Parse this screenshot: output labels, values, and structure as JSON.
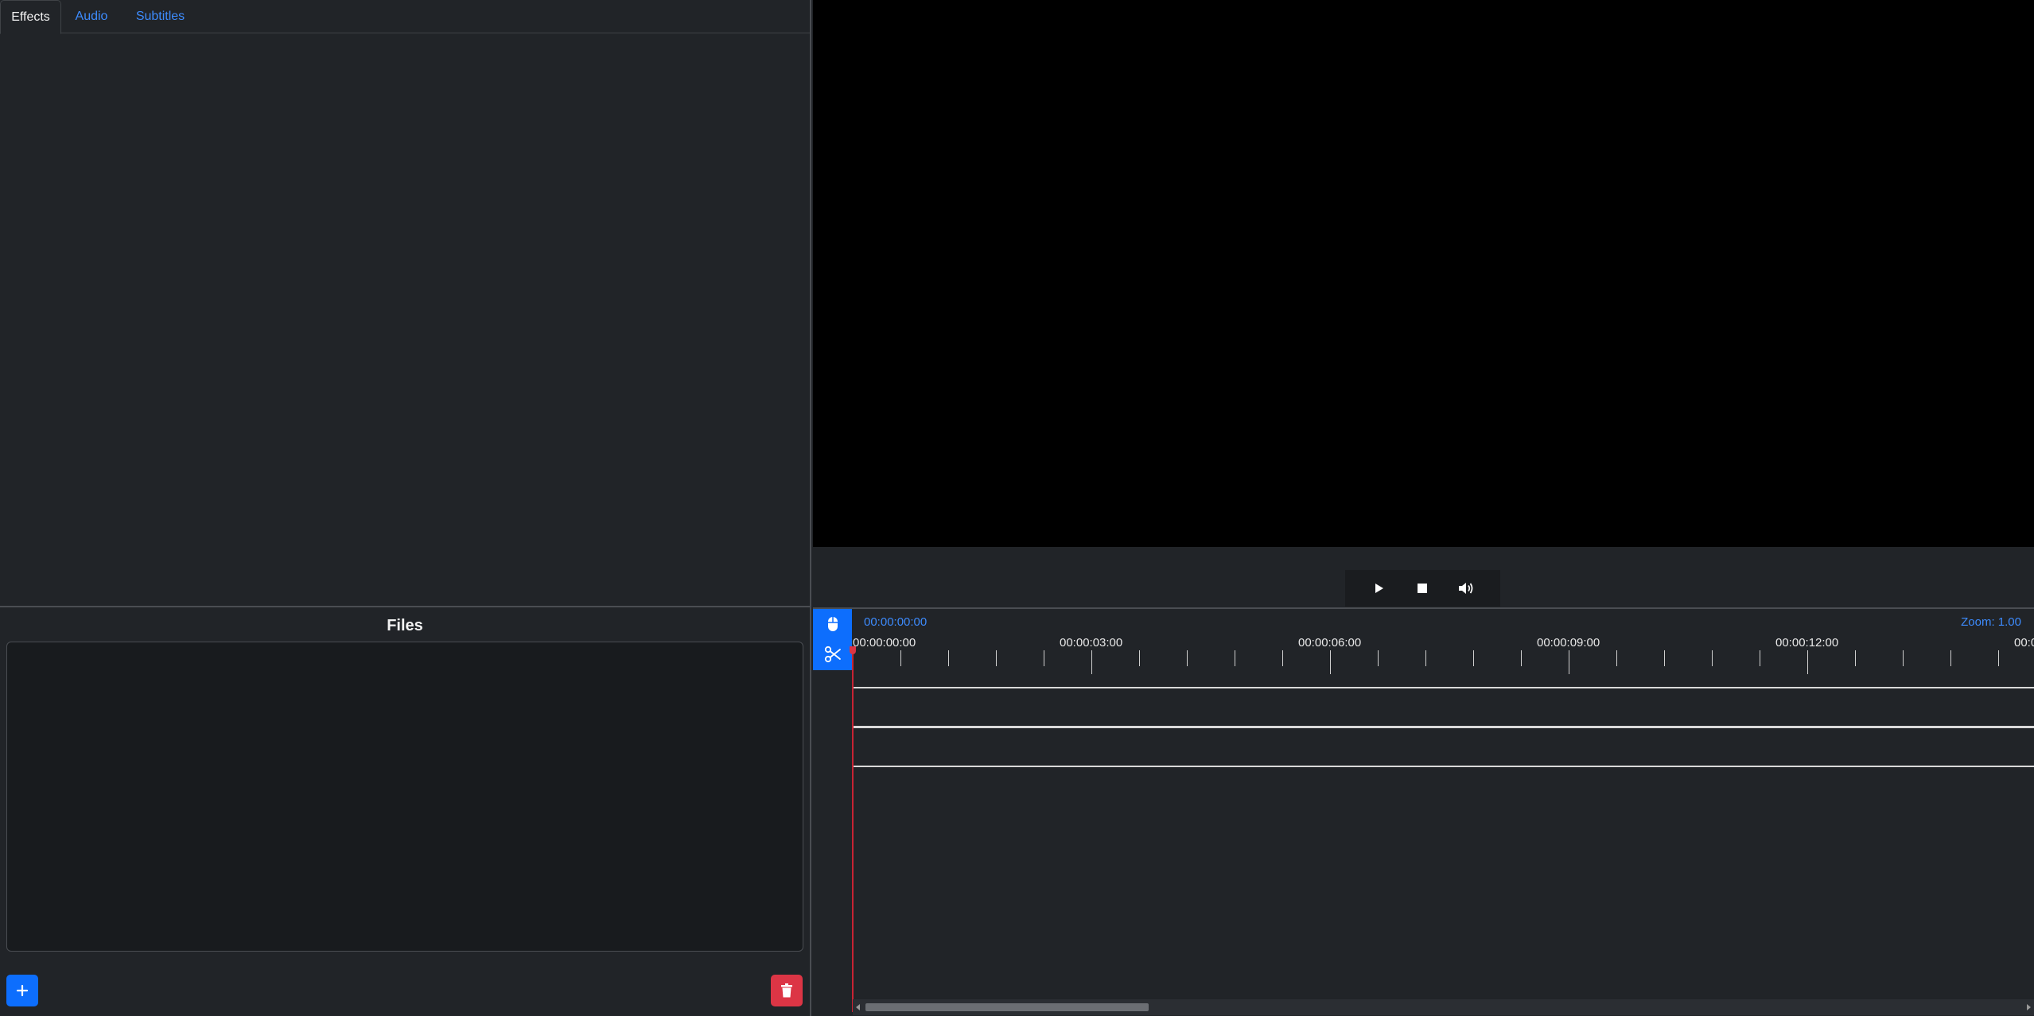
{
  "tabs": [
    {
      "label": "Effects",
      "active": true
    },
    {
      "label": "Audio",
      "active": false
    },
    {
      "label": "Subtitles",
      "active": false
    }
  ],
  "files": {
    "title": "Files",
    "items": [],
    "add_icon": "plus-icon",
    "delete_icon": "trash-icon"
  },
  "player": {
    "buttons": [
      "play-icon",
      "stop-icon",
      "volume-icon"
    ]
  },
  "timeline": {
    "timecode": "00:00:00:00",
    "zoom_label": "Zoom: 1.00",
    "tools": [
      "mouse-icon",
      "scissors-icon"
    ],
    "ruler_labels": [
      "00:00:00:00",
      "00:00:03:00",
      "00:00:06:00",
      "00:00:09:00",
      "00:00:12:00",
      "00:0"
    ],
    "playhead_time": "00:00:00:00"
  },
  "colors": {
    "accent": "#0d6efd",
    "link": "#3d8bfd",
    "danger": "#dc3545",
    "background": "#212428",
    "preview": "#000000"
  }
}
